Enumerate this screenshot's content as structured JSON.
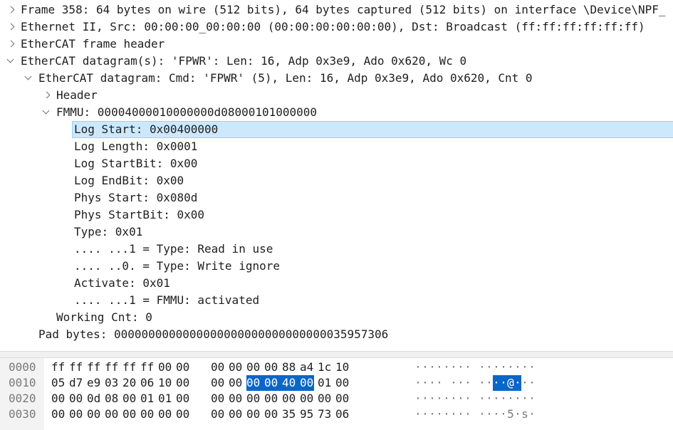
{
  "tree": [
    {
      "level": 0,
      "toggle": "collapsed",
      "text": "Frame 358: 64 bytes on wire (512 bits), 64 bytes captured (512 bits) on interface \\Device\\NPF_"
    },
    {
      "level": 0,
      "toggle": "collapsed",
      "text": "Ethernet II, Src: 00:00:00_00:00:00 (00:00:00:00:00:00), Dst: Broadcast (ff:ff:ff:ff:ff:ff)"
    },
    {
      "level": 0,
      "toggle": "collapsed",
      "text": "EtherCAT frame header"
    },
    {
      "level": 0,
      "toggle": "expanded",
      "text": "EtherCAT datagram(s): 'FPWR': Len: 16, Adp 0x3e9, Ado 0x620, Wc 0"
    },
    {
      "level": 1,
      "toggle": "expanded",
      "text": "EtherCAT datagram: Cmd: 'FPWR' (5), Len: 16, Adp 0x3e9, Ado 0x620, Cnt 0"
    },
    {
      "level": 2,
      "toggle": "collapsed",
      "text": "Header"
    },
    {
      "level": 2,
      "toggle": "expanded",
      "text": "FMMU: 00004000010000000d08000101000000"
    },
    {
      "level": 3,
      "toggle": "none",
      "text": "Log Start: 0x00400000",
      "selected": true
    },
    {
      "level": 3,
      "toggle": "none",
      "text": "Log Length: 0x0001"
    },
    {
      "level": 3,
      "toggle": "none",
      "text": "Log StartBit: 0x00"
    },
    {
      "level": 3,
      "toggle": "none",
      "text": "Log EndBit: 0x00"
    },
    {
      "level": 3,
      "toggle": "none",
      "text": "Phys Start: 0x080d"
    },
    {
      "level": 3,
      "toggle": "none",
      "text": "Phys StartBit: 0x00"
    },
    {
      "level": 3,
      "toggle": "none",
      "text": "Type: 0x01"
    },
    {
      "level": 3,
      "toggle": "none",
      "text": ".... ...1 = Type: Read in use"
    },
    {
      "level": 3,
      "toggle": "none",
      "text": ".... ..0. = Type: Write ignore"
    },
    {
      "level": 3,
      "toggle": "none",
      "text": "Activate: 0x01"
    },
    {
      "level": 3,
      "toggle": "none",
      "text": ".... ...1 = FMMU: activated"
    },
    {
      "level": 2,
      "toggle": "none",
      "text": "Working Cnt: 0"
    },
    {
      "level": 1,
      "toggle": "none",
      "text": "Pad bytes: 0000000000000000000000000000000035957306"
    }
  ],
  "bytes": [
    {
      "offset": "0000",
      "hex": [
        "ff",
        "ff",
        "ff",
        "ff",
        "ff",
        "ff",
        "00",
        "00",
        "00",
        "00",
        "00",
        "00",
        "88",
        "a4",
        "1c",
        "10"
      ],
      "ascii": [
        "·",
        "·",
        "·",
        "·",
        "·",
        "·",
        "·",
        "·",
        "·",
        "·",
        "·",
        "·",
        "·",
        "·",
        "·",
        "·"
      ],
      "hl": []
    },
    {
      "offset": "0010",
      "hex": [
        "05",
        "d7",
        "e9",
        "03",
        "20",
        "06",
        "10",
        "00",
        "00",
        "00",
        "00",
        "00",
        "40",
        "00",
        "01",
        "00"
      ],
      "ascii": [
        "·",
        "·",
        "·",
        "·",
        " ",
        "·",
        "·",
        "·",
        "·",
        "·",
        "·",
        "·",
        "@",
        "·",
        "·",
        "·"
      ],
      "hl": [
        10,
        11,
        12,
        13
      ]
    },
    {
      "offset": "0020",
      "hex": [
        "00",
        "00",
        "0d",
        "08",
        "00",
        "01",
        "01",
        "00",
        "00",
        "00",
        "00",
        "00",
        "00",
        "00",
        "00",
        "00"
      ],
      "ascii": [
        "·",
        "·",
        "·",
        "·",
        "·",
        "·",
        "·",
        "·",
        "·",
        "·",
        "·",
        "·",
        "·",
        "·",
        "·",
        "·"
      ],
      "hl": []
    },
    {
      "offset": "0030",
      "hex": [
        "00",
        "00",
        "00",
        "00",
        "00",
        "00",
        "00",
        "00",
        "00",
        "00",
        "00",
        "00",
        "35",
        "95",
        "73",
        "06"
      ],
      "ascii": [
        "·",
        "·",
        "·",
        "·",
        "·",
        "·",
        "·",
        "·",
        "·",
        "·",
        "·",
        "·",
        "5",
        "·",
        "s",
        "·"
      ],
      "hl": []
    }
  ]
}
